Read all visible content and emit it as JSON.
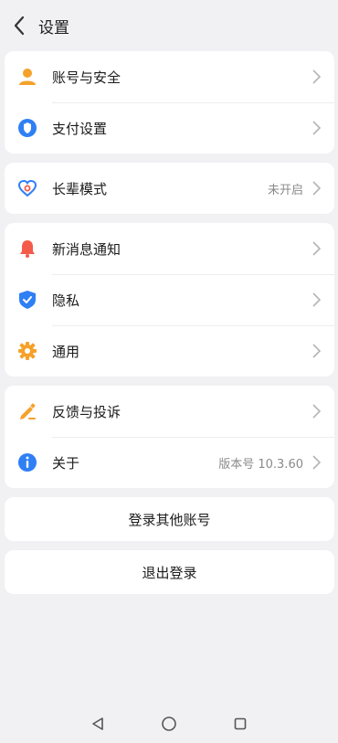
{
  "header": {
    "title": "设置"
  },
  "groups": [
    {
      "items": [
        {
          "label": "账号与安全",
          "icon": "account-icon"
        },
        {
          "label": "支付设置",
          "icon": "payment-shield-icon"
        }
      ]
    },
    {
      "items": [
        {
          "label": "长辈模式",
          "value": "未开启",
          "icon": "elder-mode-icon"
        }
      ]
    },
    {
      "items": [
        {
          "label": "新消息通知",
          "icon": "bell-icon"
        },
        {
          "label": "隐私",
          "icon": "privacy-shield-icon"
        },
        {
          "label": "通用",
          "icon": "gear-icon"
        }
      ]
    },
    {
      "items": [
        {
          "label": "反馈与投诉",
          "icon": "pen-icon"
        },
        {
          "label": "关于",
          "value": "版本号 10.3.60",
          "icon": "info-icon"
        }
      ]
    }
  ],
  "actions": {
    "switch_account": "登录其他账号",
    "logout": "退出登录"
  },
  "colors": {
    "orange": "#f5a12a",
    "blue": "#2f7ff5",
    "red": "#f45a4a",
    "background": "#f1f1f3"
  },
  "navbar": {
    "icons": [
      "back-triangle-icon",
      "home-circle-icon",
      "recents-square-icon"
    ]
  }
}
